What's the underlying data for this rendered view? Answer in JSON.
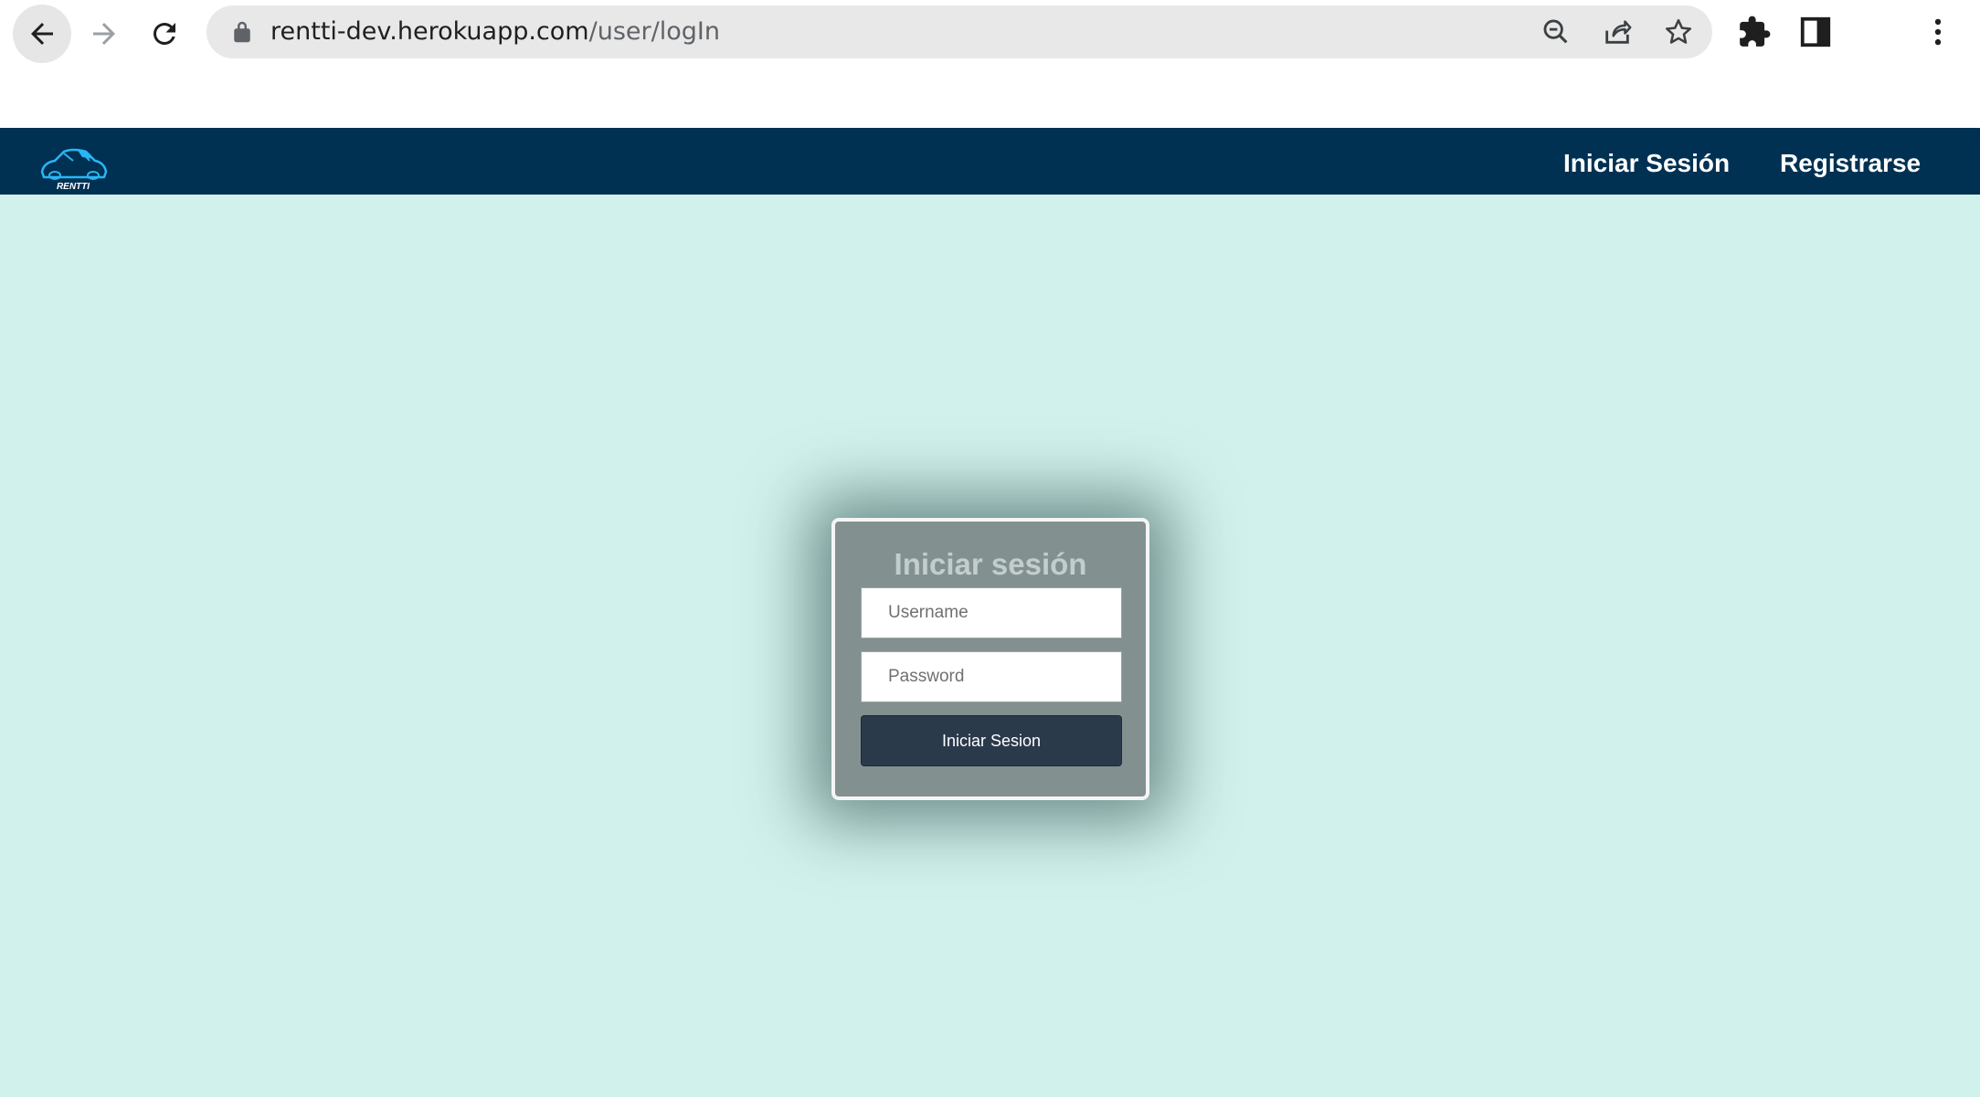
{
  "browser": {
    "url_host": "rentti-dev.herokuapp.com",
    "url_path": "/user/logIn"
  },
  "site_nav": {
    "logo_text": "RENTTI",
    "links": [
      "Iniciar Sesión",
      "Registrarse"
    ]
  },
  "login_form": {
    "title": "Iniciar sesión",
    "username_placeholder": "Username",
    "password_placeholder": "Password",
    "submit_label": "Iniciar Sesion"
  },
  "colors": {
    "navbar": "#003153",
    "page_background": "#d1f2ec",
    "card_background": "#829190",
    "button_background": "#2b3a4b",
    "logo_accent": "#29b6f6"
  },
  "icons": [
    "back-arrow-icon",
    "forward-arrow-icon",
    "reload-icon",
    "lock-icon",
    "zoom-out-icon",
    "share-icon",
    "star-icon",
    "puzzle-icon",
    "side-panel-icon",
    "kebab-menu-icon",
    "car-logo-icon"
  ]
}
